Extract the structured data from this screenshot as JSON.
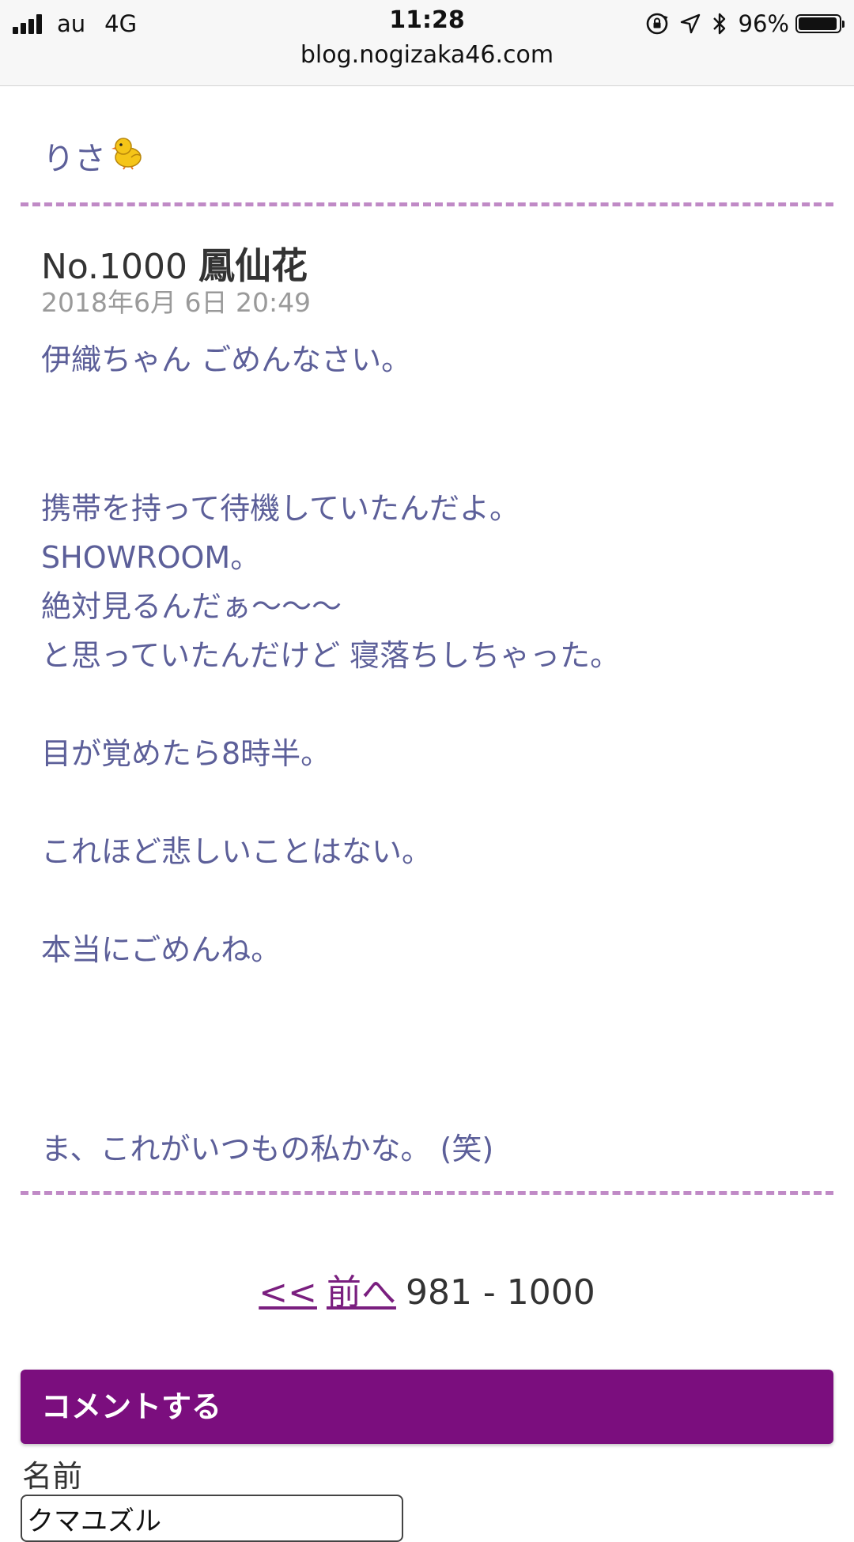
{
  "status_bar": {
    "carrier": "au",
    "network": "4G",
    "time": "11:28",
    "battery_pct": "96%",
    "battery_level": 0.96,
    "url": "blog.nogizaka46.com",
    "icons": [
      "signal-icon",
      "orientation-lock-icon",
      "location-arrow-icon",
      "bluetooth-icon",
      "battery-icon"
    ]
  },
  "blog": {
    "author": "りさ",
    "author_icon": "chick-icon",
    "post": {
      "number": "No.1000",
      "title": "鳳仙花",
      "date": "2018年6月 6日 20:49",
      "lines": [
        "伊織ちゃん ごめんなさい。",
        "携帯を持って待機していたんだよ。",
        "SHOWROOM。",
        "絶対見るんだぁ〜〜〜",
        "と思っていたんだけど 寝落ちしちゃった。",
        "目が覚めたら8時半。",
        "これほど悲しいことはない。",
        "本当にごめんね。",
        "ま、これがいつもの私かな。 (笑)"
      ]
    },
    "pager": {
      "first_label": "<<",
      "prev_label": "前へ",
      "range": "981 - 1000"
    },
    "comment": {
      "header": "コメントする",
      "name_label": "名前",
      "name_value": "クマユズル"
    },
    "colors": {
      "body_text": "#5c5f99",
      "divider": "#c08ac6",
      "comment_header_bg": "#7b0e7e",
      "link": "#7a1f7f"
    }
  }
}
